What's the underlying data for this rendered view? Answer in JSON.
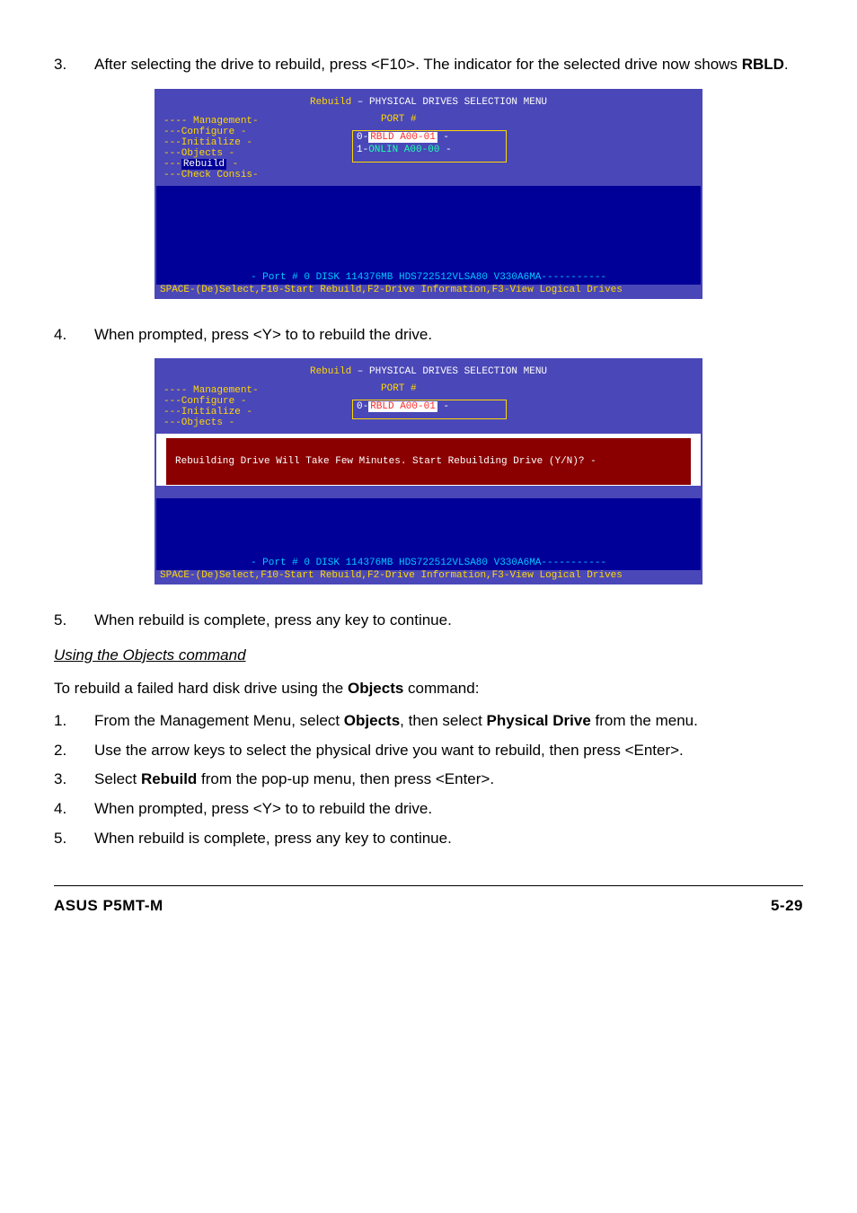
{
  "step3": {
    "num": "3.",
    "text_a": "After selecting the drive to rebuild, press <F10>. The indicator for the selected drive now shows ",
    "text_bold": "RBLD",
    "text_c": "."
  },
  "bios1": {
    "title_prefix": "--------",
    "title_yellow": "Rebuild",
    "title_white": " – PHYSICAL DRIVES SELECTION MENU",
    "title_suffix": "----------------",
    "menu": {
      "l1": "---- Management-",
      "l2": "---Configure   -",
      "l3": "---Initialize  -",
      "l4": "---Objects     -",
      "l5_pre": "---",
      "l5_sel": "Rebuild",
      "l5_post": "   -",
      "l6": "---Check Consis-"
    },
    "port_hdr": "PORT #",
    "port_row0": {
      "pre": "0-",
      "red": "RBLD  A00-01",
      "post": " -"
    },
    "port_row1": {
      "pre": "1-",
      "txt": "ONLIN A00-00",
      "post": " -"
    },
    "portinfo": "- Port # 0   DISK    114376MB  HDS722512VLSA80     V330A6MA-----------",
    "hints": "SPACE-(De)Select,F10-Start Rebuild,F2-Drive Information,F3-View Logical Drives"
  },
  "step4": {
    "num": "4.",
    "text": "When prompted, press <Y> to to rebuild the drive."
  },
  "bios2": {
    "title_yellow": "Rebuild",
    "title_white": " – PHYSICAL DRIVES SELECTION MENU",
    "menu": {
      "l1": "---- Management-",
      "l2": "---Configure   -",
      "l3": "---Initialize  -",
      "l4": "---Objects     -"
    },
    "port_hdr": "PORT #",
    "port_row0": {
      "pre": "0-",
      "red": "RBLD  A00-01",
      "post": " -"
    },
    "prompt": "Rebuilding Drive Will Take Few Minutes. Start Rebuilding Drive (Y/N)? -",
    "portinfo": "- Port # 0   DISK    114376MB  HDS722512VLSA80     V330A6MA-----------",
    "hints": "SPACE-(De)Select,F10-Start Rebuild,F2-Drive Information,F3-View Logical Drives"
  },
  "step5": {
    "num": "5.",
    "text": "When rebuild is complete, press any key to continue."
  },
  "section": {
    "hdr": "Using the Objects command",
    "intro_a": "To rebuild a failed hard disk drive using the ",
    "intro_bold": "Objects",
    "intro_c": " command:"
  },
  "olist": {
    "i1": {
      "n": "1.",
      "a": "From the Management Menu, select ",
      "b1": "Objects",
      "mid": ", then select ",
      "b2": "Physical Drive",
      "c": " from the menu."
    },
    "i2": {
      "n": "2.",
      "a": "Use the arrow keys to select the physical drive you want to rebuild, then press <Enter>."
    },
    "i3": {
      "n": "3.",
      "a": "Select ",
      "b1": "Rebuild",
      "c": " from the pop-up menu, then press <Enter>."
    },
    "i4": {
      "n": "4.",
      "a": "When prompted, press <Y> to to rebuild the drive."
    },
    "i5": {
      "n": "5.",
      "a": "When rebuild is complete, press any key to continue."
    }
  },
  "footer": {
    "left": "ASUS P5MT-M",
    "right": "5-29"
  }
}
